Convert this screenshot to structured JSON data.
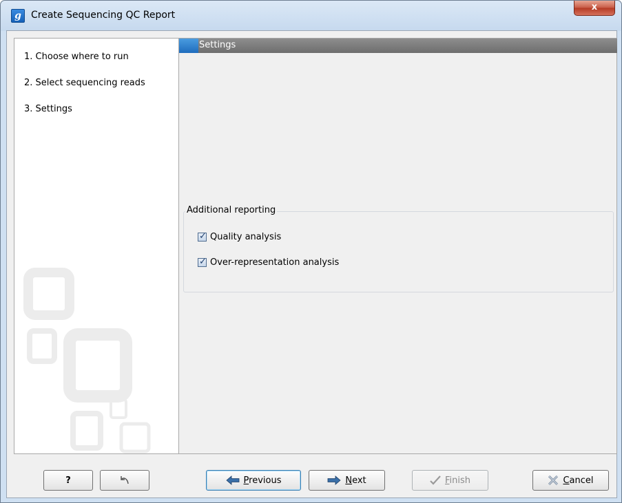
{
  "window": {
    "title": "Create Sequencing QC Report",
    "app_icon_letter": "g",
    "close_label": "x"
  },
  "sidebar": {
    "steps": [
      {
        "number": "1.",
        "label": "Choose where to run"
      },
      {
        "number": "2.",
        "label": "Select sequencing reads"
      },
      {
        "number": "3.",
        "label": "Settings"
      }
    ]
  },
  "main": {
    "header_title": "Settings",
    "group": {
      "title": "Additional reporting",
      "options": [
        {
          "label": "Quality analysis",
          "checked": true
        },
        {
          "label": "Over-representation analysis",
          "checked": true
        }
      ]
    }
  },
  "footer": {
    "help_label": "?",
    "reset_icon": "reset-arrow-icon",
    "previous": {
      "mnemonic": "P",
      "rest": "revious"
    },
    "next": {
      "mnemonic": "N",
      "rest": "ext"
    },
    "finish": {
      "mnemonic": "F",
      "rest": "inish"
    },
    "cancel": {
      "mnemonic": "C",
      "rest": "ancel"
    }
  },
  "colors": {
    "header_blue": "#1f6cbd",
    "header_gray": "#6e6e6e",
    "close_red": "#c75a45"
  }
}
